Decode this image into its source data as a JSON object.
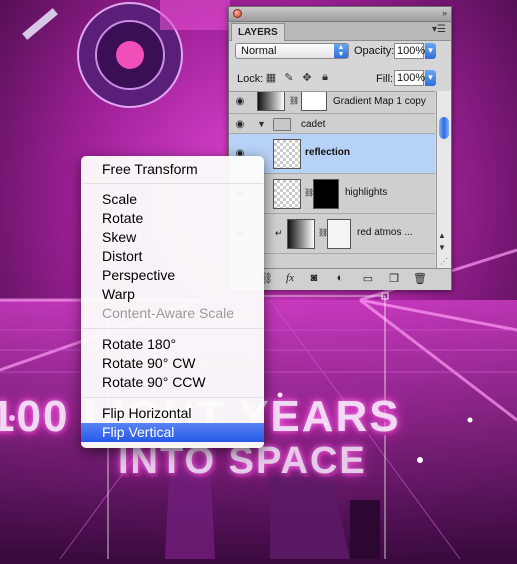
{
  "artwork": {
    "headline": "100 LIGHT YEARS",
    "subline": "INTO SPACE",
    "colors": {
      "bg_dark": "#3a0a3f",
      "magenta": "#e23fd4",
      "pink_glow": "#ff7cf1",
      "violet": "#8a2ba8"
    }
  },
  "layers_panel": {
    "tab_label": "LAYERS",
    "blend_mode": "Normal",
    "opacity_label": "Opacity:",
    "opacity_value": "100%",
    "lock_label": "Lock:",
    "fill_label": "Fill:",
    "fill_value": "100%",
    "layers": [
      {
        "name": "Gradient Map 1 copy",
        "type": "adjustment"
      },
      {
        "name": "cadet",
        "type": "group"
      },
      {
        "name": "reflection",
        "type": "layer",
        "selected": true
      },
      {
        "name": "highlights",
        "type": "masked-layer"
      },
      {
        "name": "red atmos ...",
        "type": "clipped-adjustment"
      }
    ],
    "icons": [
      "link-icon",
      "fx-icon",
      "mask-icon",
      "adjustment-icon",
      "folder-icon",
      "new-layer-icon",
      "trash-icon"
    ],
    "selected_color": "#b7d2f7"
  },
  "context_menu": {
    "groups": [
      [
        {
          "label": "Free Transform",
          "enabled": true
        }
      ],
      [
        {
          "label": "Scale",
          "enabled": true
        },
        {
          "label": "Rotate",
          "enabled": true
        },
        {
          "label": "Skew",
          "enabled": true
        },
        {
          "label": "Distort",
          "enabled": true
        },
        {
          "label": "Perspective",
          "enabled": true
        },
        {
          "label": "Warp",
          "enabled": true
        },
        {
          "label": "Content-Aware Scale",
          "enabled": false
        }
      ],
      [
        {
          "label": "Rotate 180°",
          "enabled": true
        },
        {
          "label": "Rotate 90° CW",
          "enabled": true
        },
        {
          "label": "Rotate 90° CCW",
          "enabled": true
        }
      ],
      [
        {
          "label": "Flip Horizontal",
          "enabled": true
        },
        {
          "label": "Flip Vertical",
          "enabled": true,
          "highlighted": true
        }
      ]
    ],
    "highlight_color": "#2f62ea"
  }
}
